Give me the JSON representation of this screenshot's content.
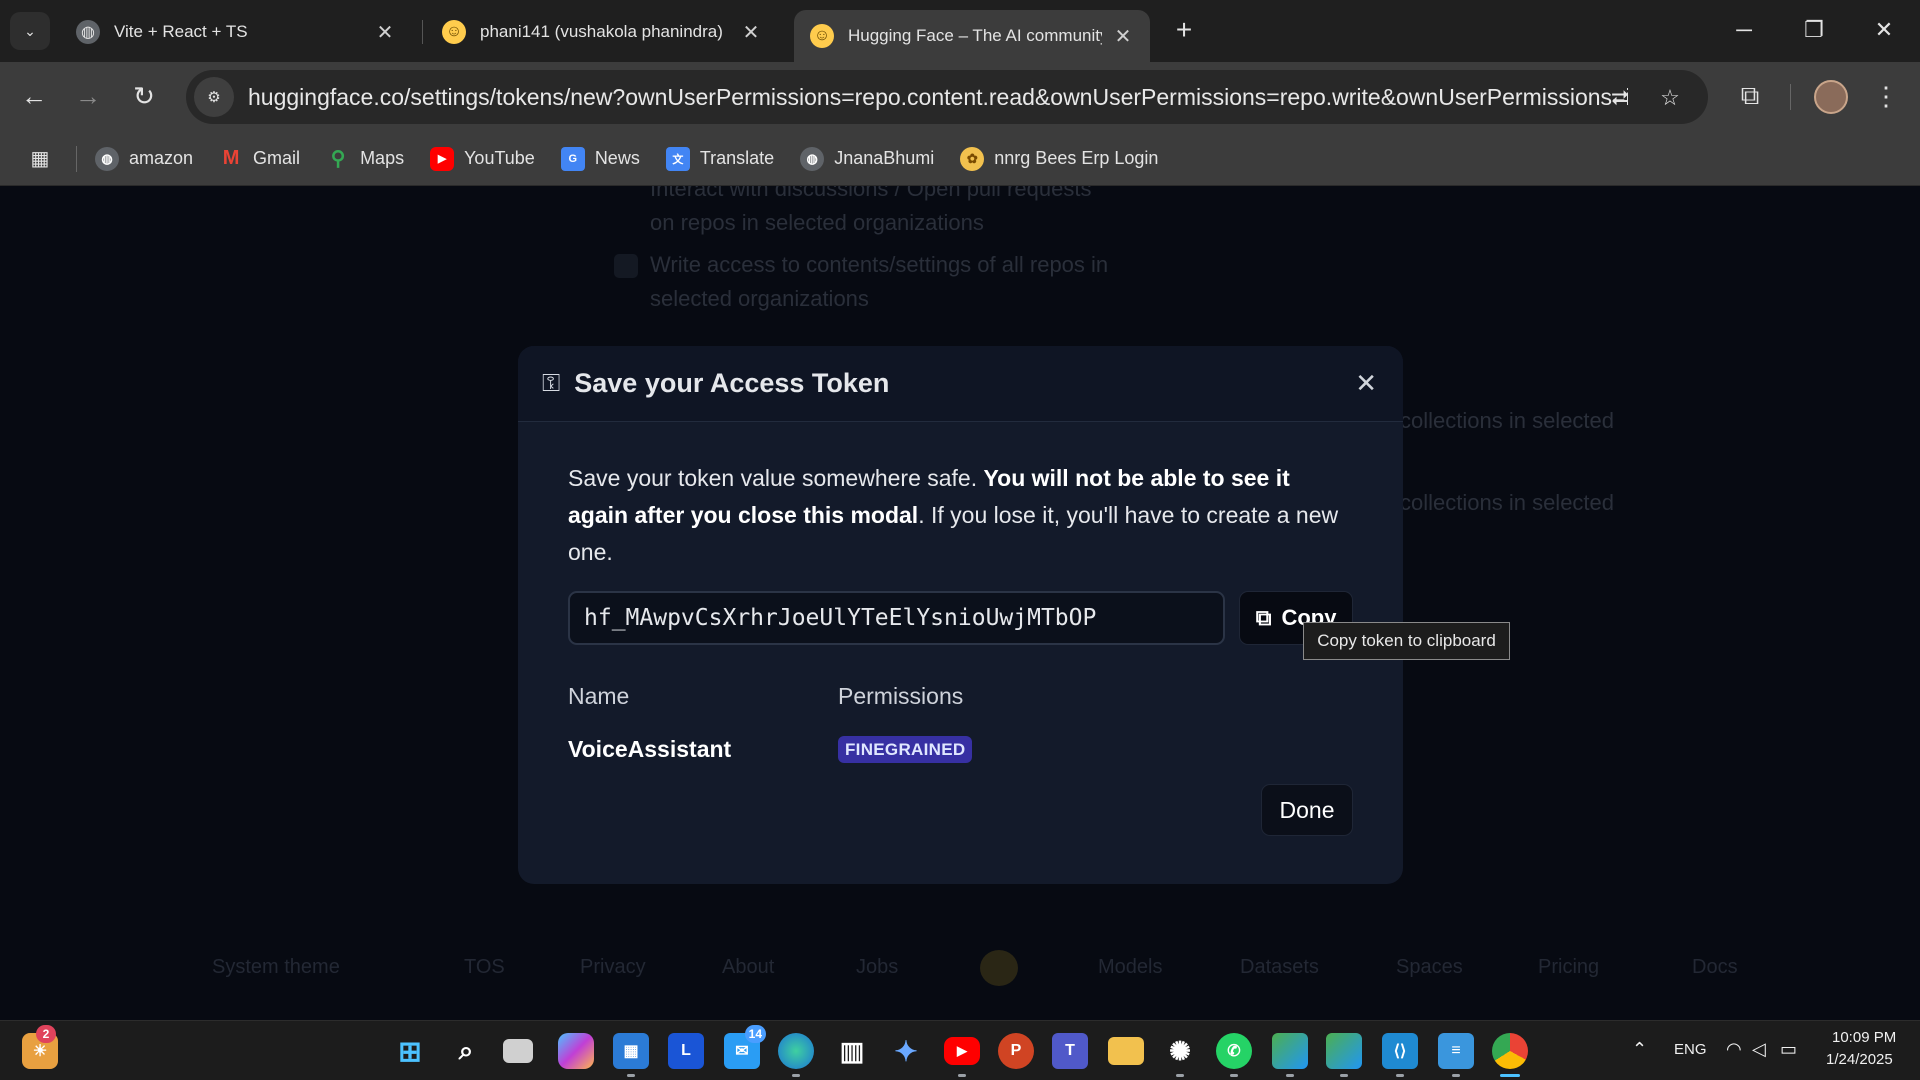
{
  "browser": {
    "tabs": [
      {
        "title": "Vite + React + TS",
        "favicon": "globe-icon"
      },
      {
        "title": "phani141 (vushakola phanindra)",
        "favicon": "hugging-face-icon"
      },
      {
        "title": "Hugging Face – The AI community",
        "favicon": "hugging-face-icon"
      }
    ],
    "url": "huggingface.co/settings/tokens/new?ownUserPermissions=repo.content.read&ownUserPermissions=repo.write&ownUserPermissions=infer...",
    "bookmarks": [
      {
        "label": "amazon",
        "icon": "globe-icon"
      },
      {
        "label": "Gmail",
        "icon": "gmail-icon"
      },
      {
        "label": "Maps",
        "icon": "maps-icon"
      },
      {
        "label": "YouTube",
        "icon": "youtube-icon"
      },
      {
        "label": "News",
        "icon": "news-icon"
      },
      {
        "label": "Translate",
        "icon": "translate-icon"
      },
      {
        "label": "JnanaBhumi",
        "icon": "globe-icon"
      },
      {
        "label": "nnrg Bees Erp Login",
        "icon": "erp-icon"
      }
    ]
  },
  "background_page": {
    "texts": [
      "Interact with discussions / Open pull requests on repos in selected organizations",
      "Write access to contents/settings of all repos in selected organizations",
      "collections in selected",
      "collections in selected"
    ],
    "footer": [
      "System theme",
      "TOS",
      "Privacy",
      "About",
      "Jobs",
      "Models",
      "Datasets",
      "Spaces",
      "Pricing",
      "Docs"
    ]
  },
  "modal": {
    "title": "Save your Access Token",
    "desc_part1": "Save your token value somewhere safe. ",
    "desc_bold": "You will not be able to see it again after you close this modal",
    "desc_part2": ". If you lose it, you'll have to create a new one.",
    "token": "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",
    "copy_label": "Copy",
    "copy_tooltip": "Copy token to clipboard",
    "col_name": "Name",
    "col_permissions": "Permissions",
    "token_name": "VoiceAssistant",
    "permission_badge": "FINEGRAINED",
    "done_label": "Done"
  },
  "taskbar": {
    "notification_count": "2",
    "mail_badge": "14",
    "lang": "ENG",
    "time": "10:09 PM",
    "date": "1/24/2025"
  }
}
